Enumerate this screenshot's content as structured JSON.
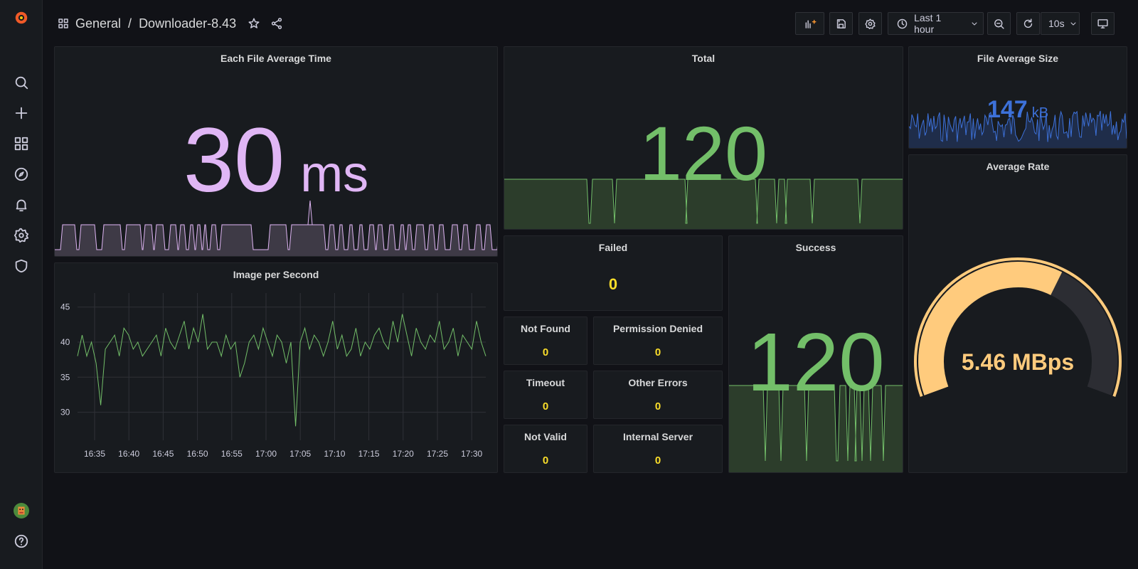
{
  "breadcrumb": {
    "folder": "General",
    "separator": "/",
    "dashboard": "Downloader-8.43"
  },
  "toolbar": {
    "time_range": "Last 1 hour",
    "refresh_interval": "10s"
  },
  "sidebar": {
    "items": [
      "grafana-logo",
      "search-icon",
      "plus-icon",
      "dashboards-icon",
      "explore-icon",
      "alerting-icon",
      "settings-icon",
      "shield-icon",
      "avatar",
      "help-icon"
    ]
  },
  "panels": {
    "each_file_avg": {
      "title": "Each File Average Time",
      "value": "30",
      "unit": "ms",
      "color": "#e0b6f5"
    },
    "total": {
      "title": "Total",
      "value": "120",
      "color": "#73bf69"
    },
    "file_avg_size": {
      "title": "File Average Size",
      "value": "147",
      "unit": "kB",
      "color": "#3d71d9"
    },
    "image_per_second": {
      "title": "Image per Second"
    },
    "failed": {
      "title": "Failed",
      "value": "0"
    },
    "success": {
      "title": "Success",
      "value": "120",
      "color": "#73bf69"
    },
    "average_rate": {
      "title": "Average Rate",
      "value": "5.46 MBps",
      "color": "#ffcb7d",
      "gauge_fraction": 0.62
    },
    "not_found": {
      "title": "Not Found",
      "value": "0"
    },
    "permission_denied": {
      "title": "Permission Denied",
      "value": "0"
    },
    "timeout": {
      "title": "Timeout",
      "value": "0"
    },
    "other_errors": {
      "title": "Other Errors",
      "value": "0"
    },
    "not_valid": {
      "title": "Not Valid",
      "value": "0"
    },
    "internal_server": {
      "title": "Internal Server",
      "value": "0"
    }
  },
  "chart_data": {
    "type": "line",
    "title": "Image per Second",
    "x_ticks": [
      "16:35",
      "16:40",
      "16:45",
      "16:50",
      "16:55",
      "17:00",
      "17:05",
      "17:10",
      "17:15",
      "17:20",
      "17:25",
      "17:30"
    ],
    "y_ticks": [
      30,
      35,
      40,
      45
    ],
    "ylim": [
      26,
      47
    ],
    "grid": true,
    "series": [
      {
        "color": "#73bf69",
        "values": [
          38,
          41,
          38,
          40,
          37,
          31,
          39,
          40,
          41,
          38,
          42,
          41,
          39,
          40,
          38,
          39,
          40,
          41,
          38,
          42,
          40,
          39,
          41,
          43,
          39,
          42,
          40,
          44,
          39,
          40,
          40,
          38,
          41,
          39,
          40,
          35,
          37,
          40,
          41,
          39,
          42,
          40,
          38,
          41,
          40,
          37,
          40,
          28,
          40,
          42,
          39,
          41,
          40,
          38,
          40,
          43,
          39,
          41,
          38,
          39,
          42,
          38,
          40,
          39,
          41,
          42,
          40,
          39,
          43,
          40,
          44,
          41,
          38,
          42,
          40,
          39,
          41,
          40,
          43,
          39,
          40,
          42,
          38,
          41,
          40,
          39,
          43,
          40,
          38
        ]
      }
    ]
  }
}
